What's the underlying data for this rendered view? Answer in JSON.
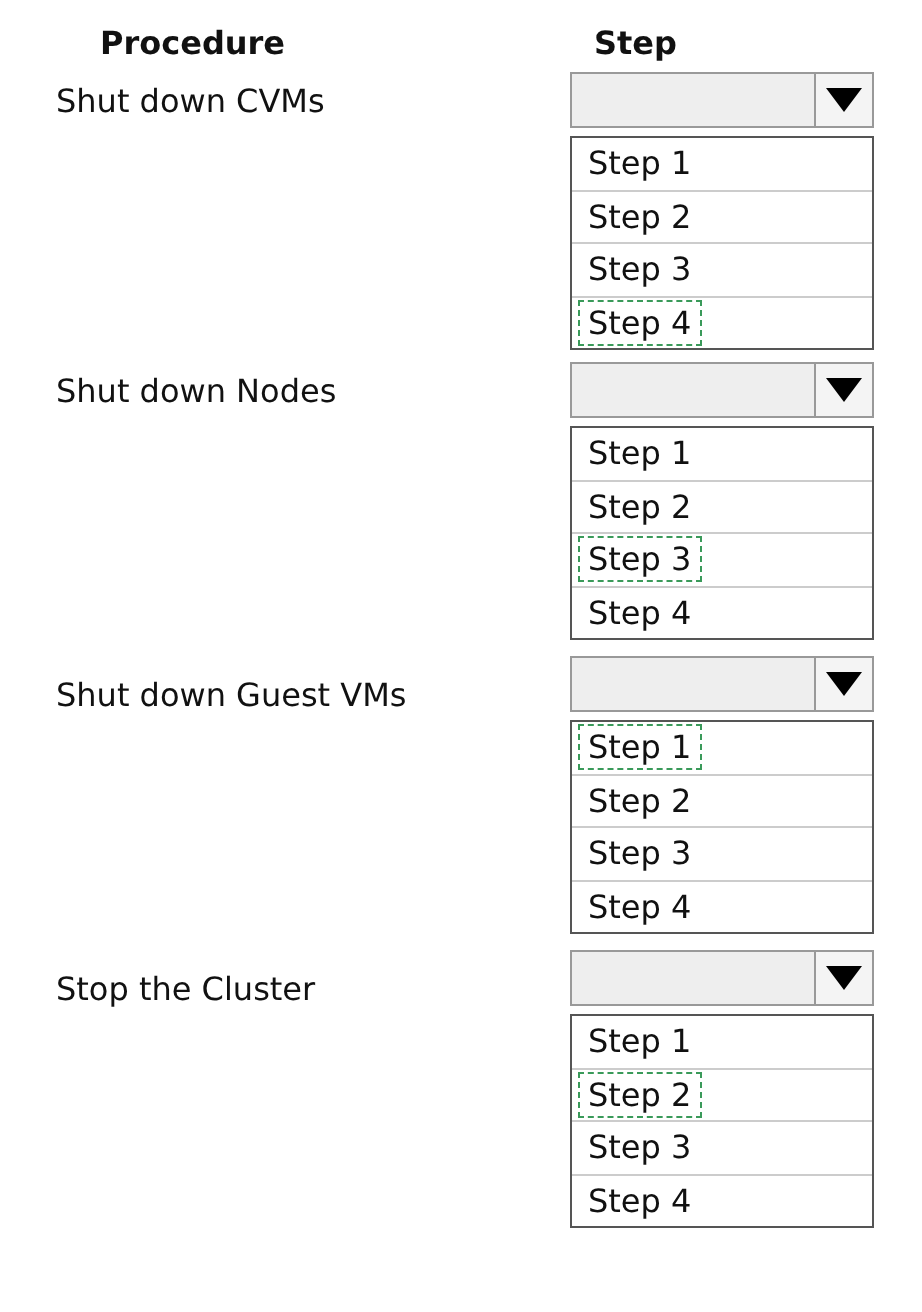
{
  "headers": {
    "procedure": "Procedure",
    "step": "Step"
  },
  "procedures": [
    {
      "label": "Shut  down CVMs",
      "options": [
        {
          "label": "Step 1",
          "selected": false
        },
        {
          "label": "Step 2",
          "selected": false
        },
        {
          "label": "Step 3",
          "selected": false
        },
        {
          "label": "Step 4",
          "selected": true
        }
      ]
    },
    {
      "label": "Shut down Nodes",
      "options": [
        {
          "label": "Step 1",
          "selected": false
        },
        {
          "label": "Step 2",
          "selected": false
        },
        {
          "label": "Step 3",
          "selected": true
        },
        {
          "label": "Step 4",
          "selected": false
        }
      ]
    },
    {
      "label": "Shut down Guest VMs",
      "options": [
        {
          "label": "Step 1",
          "selected": true
        },
        {
          "label": "Step 2",
          "selected": false
        },
        {
          "label": "Step 3",
          "selected": false
        },
        {
          "label": "Step 4",
          "selected": false
        }
      ]
    },
    {
      "label": "Stop the Cluster",
      "options": [
        {
          "label": "Step 1",
          "selected": false
        },
        {
          "label": "Step 2",
          "selected": true
        },
        {
          "label": "Step 3",
          "selected": false
        },
        {
          "label": "Step 4",
          "selected": false
        }
      ]
    }
  ]
}
